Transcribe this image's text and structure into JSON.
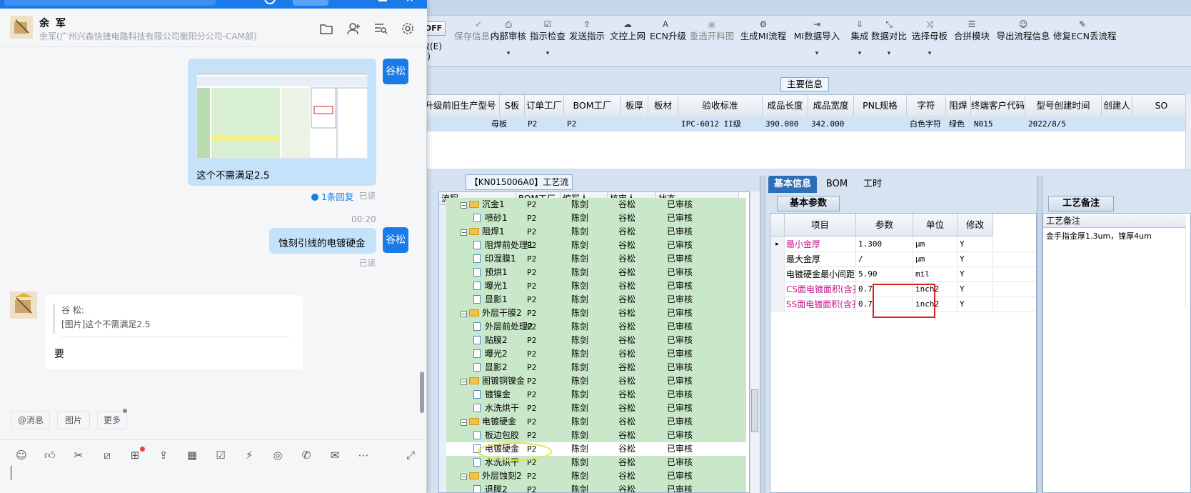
{
  "toolbar": {
    "off_label": "OFF",
    "left_line1": "改(E)",
    "left_line2": "Z)",
    "buttons": [
      {
        "label": "保存信息(S)",
        "icon": "✔",
        "disabled": true,
        "dropdown": false
      },
      {
        "label": "内部审核",
        "icon": "⎙",
        "disabled": false,
        "dropdown": true
      },
      {
        "label": "指示检查",
        "icon": "☑",
        "disabled": false,
        "dropdown": true
      },
      {
        "label": "发送指示",
        "icon": "⇪",
        "disabled": false,
        "dropdown": false
      },
      {
        "label": "文控上网",
        "icon": "☁",
        "disabled": false,
        "dropdown": false
      },
      {
        "label": "ECN升级",
        "icon": "A",
        "disabled": false,
        "dropdown": false
      },
      {
        "label": "重选开料图",
        "icon": "▣",
        "disabled": true,
        "dropdown": false
      },
      {
        "label": "生成MI流程",
        "icon": "⚙",
        "disabled": false,
        "dropdown": false
      },
      {
        "label": "MI数据导入",
        "icon": "⇥",
        "disabled": false,
        "dropdown": true
      },
      {
        "label": "集成",
        "icon": "⇩",
        "disabled": false,
        "dropdown": true
      },
      {
        "label": "数据对比",
        "icon": "⤡",
        "disabled": false,
        "dropdown": true
      },
      {
        "label": "选择母板",
        "icon": "⤨",
        "disabled": false,
        "dropdown": true
      },
      {
        "label": "合拼模块",
        "icon": "☰",
        "disabled": false,
        "dropdown": false
      },
      {
        "label": "导出流程信息",
        "icon": "☺",
        "disabled": false,
        "dropdown": false
      },
      {
        "label": "修复ECN丢流程",
        "icon": "✎",
        "disabled": false,
        "dropdown": false
      }
    ]
  },
  "main_info": {
    "title": "主要信息",
    "columns": [
      "升级前旧生产型号",
      "S板",
      "订单工厂",
      "BOM工厂",
      "板厚",
      "板材",
      "验收标准",
      "成品长度",
      "成品宽度",
      "PNL规格",
      "字符",
      "阻焊",
      "终端客户代码",
      "型号创建时间",
      "创建人",
      "SO"
    ],
    "row": [
      "",
      "母板",
      "P2",
      "P2",
      "",
      "",
      "IPC-6012 II级",
      "390.000",
      "342.000",
      "",
      "白色字符",
      "绿色",
      "N015",
      "2022/8/5",
      "",
      ""
    ]
  },
  "tree": {
    "title": "【KN015006A0】工艺流程",
    "columns": [
      "流程",
      "BOM工厂",
      "编写人",
      "核审人",
      "状态"
    ],
    "rows": [
      {
        "name": "沉金1",
        "level": 0,
        "folder": true,
        "bom": "P2",
        "writer": "陈剑",
        "reviewer": "谷松",
        "status": "已审核"
      },
      {
        "name": "喷砂1",
        "level": 1,
        "folder": false,
        "bom": "P2",
        "writer": "陈剑",
        "reviewer": "谷松",
        "status": "已审核"
      },
      {
        "name": "阻焊1",
        "level": 0,
        "folder": true,
        "bom": "P2",
        "writer": "陈剑",
        "reviewer": "谷松",
        "status": "已审核"
      },
      {
        "name": "阻焊前处理1",
        "level": 1,
        "folder": false,
        "bom": "P2",
        "writer": "陈剑",
        "reviewer": "谷松",
        "status": "已审核"
      },
      {
        "name": "印湿膜1",
        "level": 1,
        "folder": false,
        "bom": "P2",
        "writer": "陈剑",
        "reviewer": "谷松",
        "status": "已审核"
      },
      {
        "name": "预烘1",
        "level": 1,
        "folder": false,
        "bom": "P2",
        "writer": "陈剑",
        "reviewer": "谷松",
        "status": "已审核"
      },
      {
        "name": "曝光1",
        "level": 1,
        "folder": false,
        "bom": "P2",
        "writer": "陈剑",
        "reviewer": "谷松",
        "status": "已审核"
      },
      {
        "name": "显影1",
        "level": 1,
        "folder": false,
        "bom": "P2",
        "writer": "陈剑",
        "reviewer": "谷松",
        "status": "已审核"
      },
      {
        "name": "外层干膜2",
        "level": 0,
        "folder": true,
        "bom": "P2",
        "writer": "陈剑",
        "reviewer": "谷松",
        "status": "已审核"
      },
      {
        "name": "外层前处理2",
        "level": 1,
        "folder": false,
        "bom": "P2",
        "writer": "陈剑",
        "reviewer": "谷松",
        "status": "已审核"
      },
      {
        "name": "贴膜2",
        "level": 1,
        "folder": false,
        "bom": "P2",
        "writer": "陈剑",
        "reviewer": "谷松",
        "status": "已审核"
      },
      {
        "name": "曝光2",
        "level": 1,
        "folder": false,
        "bom": "P2",
        "writer": "陈剑",
        "reviewer": "谷松",
        "status": "已审核"
      },
      {
        "name": "显影2",
        "level": 1,
        "folder": false,
        "bom": "P2",
        "writer": "陈剑",
        "reviewer": "谷松",
        "status": "已审核"
      },
      {
        "name": "图镀铜镍金",
        "level": 0,
        "folder": true,
        "bom": "P2",
        "writer": "陈剑",
        "reviewer": "谷松",
        "status": "已审核"
      },
      {
        "name": "镀镍金",
        "level": 1,
        "folder": false,
        "bom": "P2",
        "writer": "陈剑",
        "reviewer": "谷松",
        "status": "已审核"
      },
      {
        "name": "水洗烘干",
        "level": 1,
        "folder": false,
        "bom": "P2",
        "writer": "陈剑",
        "reviewer": "谷松",
        "status": "已审核"
      },
      {
        "name": "电镀硬金",
        "level": 0,
        "folder": true,
        "bom": "P2",
        "writer": "陈剑",
        "reviewer": "谷松",
        "status": "已审核"
      },
      {
        "name": "板边包胶",
        "level": 1,
        "folder": false,
        "bom": "P2",
        "writer": "陈剑",
        "reviewer": "谷松",
        "status": "已审核"
      },
      {
        "name": "电镀硬金",
        "level": 1,
        "folder": false,
        "bom": "P2",
        "writer": "陈剑",
        "reviewer": "谷松",
        "status": "已审核",
        "selected": true
      },
      {
        "name": "水洗烘干",
        "level": 1,
        "folder": false,
        "bom": "P2",
        "writer": "陈剑",
        "reviewer": "谷松",
        "status": "已审核"
      },
      {
        "name": "外层蚀刻2",
        "level": 0,
        "folder": true,
        "bom": "P2",
        "writer": "陈剑",
        "reviewer": "谷松",
        "status": "已审核"
      },
      {
        "name": "退膜2",
        "level": 1,
        "folder": false,
        "bom": "P2",
        "writer": "陈剑",
        "reviewer": "谷松",
        "status": "已审核"
      }
    ]
  },
  "tabs": [
    "基本信息",
    "BOM",
    "工时"
  ],
  "params": {
    "title": "基本参数",
    "columns": [
      "项目",
      "参数",
      "单位",
      "修改"
    ],
    "rows": [
      {
        "item": "最小金厚",
        "value": "1.300",
        "unit": "μm",
        "mod": "Y",
        "pink": true
      },
      {
        "item": "最大金厚",
        "value": "/",
        "unit": "μm",
        "mod": "Y",
        "pink": false
      },
      {
        "item": "电镀硬金最小间距",
        "value": "5.90",
        "unit": "mil",
        "mod": "Y",
        "pink": false
      },
      {
        "item": "CS面电镀面积(含孔)",
        "value": "0.7",
        "unit": "inch2",
        "mod": "Y",
        "pink": true
      },
      {
        "item": "SS面电镀面积(含孔)",
        "value": "0.7",
        "unit": "inch2",
        "mod": "Y",
        "pink": true
      }
    ]
  },
  "remarks": {
    "title": "工艺备注",
    "column": "工艺备注",
    "text": "金手指金厚1.3um，镍厚4um"
  },
  "chat": {
    "contact_name": "余 军",
    "contact_org": "余军(广州兴森快捷电路科技有限公司衡阳分公司-CAM部)",
    "me_tag": "谷松",
    "msg1_text": "这个不需满足2.5",
    "msg1_reply": "1条回复",
    "read_label": "已读",
    "time2": "00:20",
    "msg2_text": "蚀刻引线的电镀硬金",
    "quote_sender": "谷 松:",
    "quote_text": "[图片]这个不需满足2.5",
    "reply_text": "要",
    "chips": [
      "@消息",
      "图片",
      "更多"
    ],
    "colors": {
      "accent": "#1a7be8",
      "my_bubble": "#c5e2fb"
    }
  }
}
